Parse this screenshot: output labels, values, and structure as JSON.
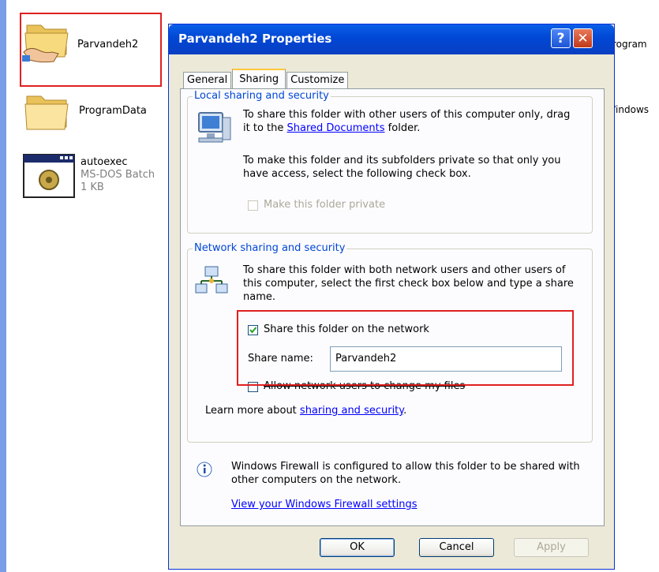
{
  "desktop": {
    "files": [
      {
        "name": "Parvandeh2"
      },
      {
        "name": "ProgramData"
      },
      {
        "name": "autoexec",
        "type": "MS-DOS Batch",
        "size": "1 KB"
      }
    ],
    "right_labels": [
      "rogram",
      "/indows"
    ]
  },
  "dialog": {
    "title": "Parvandeh2 Properties",
    "help_glyph": "?",
    "close_glyph": "✕",
    "tabs": [
      {
        "label": "General",
        "active": false
      },
      {
        "label": "Sharing",
        "active": true
      },
      {
        "label": "Customize",
        "active": false
      }
    ],
    "local": {
      "legend": "Local sharing and security",
      "text1_prefix": "To share this folder with other users of this computer only, drag it to the",
      "text1_link": "Shared Documents",
      "text1_suffix": "folder.",
      "text2": "To make this folder and its subfolders private so that only you have access, select the following check box.",
      "private_label": "Make this folder private"
    },
    "network": {
      "legend": "Network sharing and security",
      "text": "To share this folder with both network users and other users of this computer, select the first check box below and type a share name.",
      "share_label": "Share this folder on the network",
      "share_name_label": "Share name:",
      "share_name_value": "Parvandeh2",
      "allow_label": "Allow network users to change my files",
      "learn_prefix": "Learn more about",
      "learn_link": "sharing and security",
      "learn_suffix": "."
    },
    "firewall": {
      "text": "Windows Firewall is configured to allow this folder to be shared with other computers on the network.",
      "link": "View your Windows Firewall settings"
    },
    "buttons": {
      "ok": "OK",
      "cancel": "Cancel",
      "apply": "Apply"
    }
  },
  "colors": {
    "highlight": "#e02020",
    "title_blue": "#0047d4",
    "legend_blue": "#0046d5"
  }
}
